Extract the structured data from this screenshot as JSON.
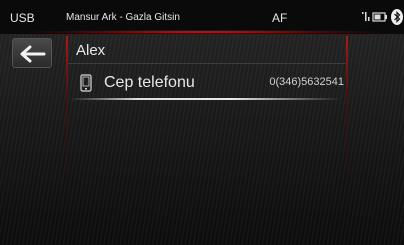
{
  "status_bar": {
    "source": "USB",
    "now_playing": "Mansur Ark - Gazla Gitsin",
    "radio_mode": "AF",
    "icons": [
      "signal-icon",
      "battery-icon",
      "bluetooth-icon"
    ]
  },
  "contact": {
    "name": "Alex"
  },
  "numbers": [
    {
      "type": "Cep telefonu",
      "value": "0(346)5632541",
      "icon": "mobile-phone-icon"
    }
  ],
  "colors": {
    "accent_red": "#e02828",
    "text": "#e8e8e8",
    "background": "#1a1a1a"
  }
}
